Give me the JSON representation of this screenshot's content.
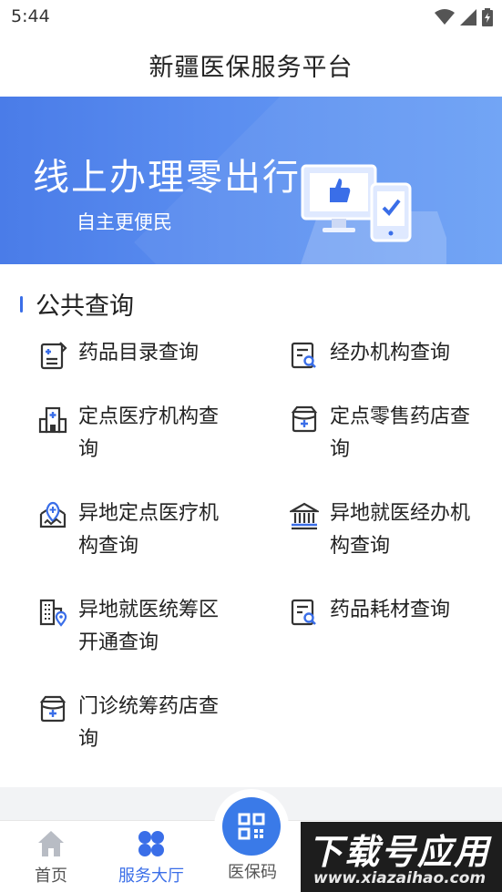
{
  "status": {
    "time": "5:44"
  },
  "header": {
    "title": "新疆医保服务平台"
  },
  "banner": {
    "title": "线上办理零出行",
    "subtitle": "自主更便民"
  },
  "section": {
    "title": "公共查询"
  },
  "items": [
    {
      "label": "药品目录查询",
      "icon": "drug-catalog-icon"
    },
    {
      "label": "经办机构查询",
      "icon": "agency-search-icon"
    },
    {
      "label": "定点医疗机构查询",
      "icon": "hospital-icon"
    },
    {
      "label": "定点零售药店查询",
      "icon": "pharmacy-icon"
    },
    {
      "label": "异地定点医疗机构查询",
      "icon": "remote-hospital-icon"
    },
    {
      "label": "异地就医经办机构查询",
      "icon": "institution-icon"
    },
    {
      "label": "异地就医统筹区开通查询",
      "icon": "region-building-icon"
    },
    {
      "label": "药品耗材查询",
      "icon": "consumables-search-icon"
    },
    {
      "label": "门诊统筹药店查询",
      "icon": "outpatient-pharmacy-icon"
    }
  ],
  "tabbar": {
    "home": "首页",
    "service": "服务大厅",
    "code": "医保码"
  },
  "watermark": {
    "main": "下载号应用",
    "sub": "www.xiazaihao.com"
  },
  "colors": {
    "accent": "#3a6ee8",
    "banner": "#5b8ef0",
    "text": "#222222"
  }
}
